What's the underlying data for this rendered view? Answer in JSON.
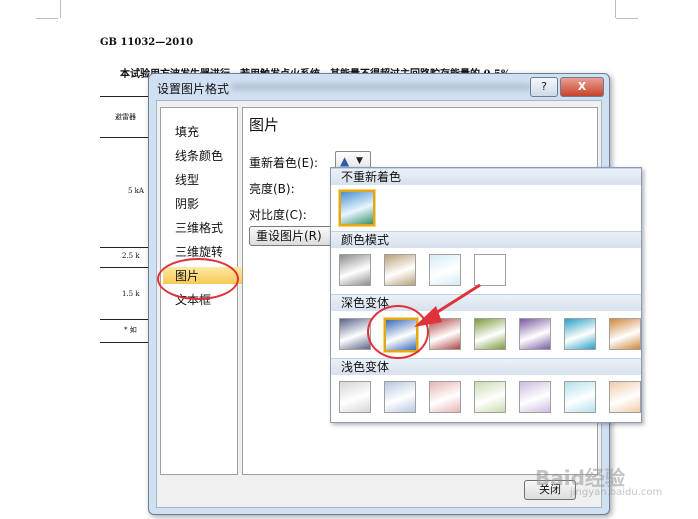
{
  "document": {
    "header": "GB 11032—2010",
    "body_line": "本试验用方波发生器进行，若用触发点火系统，其能量不得超过主回路贮存能量的 0.5%",
    "table_cells": [
      "避雷器",
      "5 kA",
      "2.5 k",
      "1.5 k",
      "* 如"
    ]
  },
  "dialog": {
    "title": "设置图片格式",
    "help_label": "?",
    "close_icon_label": "X",
    "nav_items": [
      {
        "label": "填充"
      },
      {
        "label": "线条颜色"
      },
      {
        "label": "线型"
      },
      {
        "label": "阴影"
      },
      {
        "label": "三维格式"
      },
      {
        "label": "三维旋转"
      },
      {
        "label": "图片"
      },
      {
        "label": "文本框"
      }
    ],
    "selected_nav": "图片",
    "panel": {
      "title": "图片",
      "recolor_label": "重新着色(E):",
      "brightness_label": "亮度(B):",
      "contrast_label": "对比度(C):",
      "reset_label": "重设图片(R)"
    },
    "close_button": "关闭"
  },
  "recolor_menu": {
    "sections": [
      {
        "header": "不重新着色"
      },
      {
        "header": "颜色模式"
      },
      {
        "header": "深色变体"
      },
      {
        "header": "浅色变体"
      }
    ],
    "colors": {
      "none": "#4a8fd0",
      "modes": [
        "#8c8c8c",
        "#b9a07a",
        "#d4ecf4",
        "#ffffff"
      ],
      "dark": [
        "#5a6488",
        "#3a6bb8",
        "#b34444",
        "#7a9a3c",
        "#7a5aa0",
        "#2aa0c4",
        "#d0863a"
      ],
      "light": [
        "#d6d6d6",
        "#b7c8e0",
        "#e8b4b4",
        "#c8dcae",
        "#cdbce0",
        "#b4e0ec",
        "#f0cca8"
      ]
    }
  },
  "watermark": {
    "text": "Baid经验",
    "sub": "jingyan.baidu.com"
  }
}
